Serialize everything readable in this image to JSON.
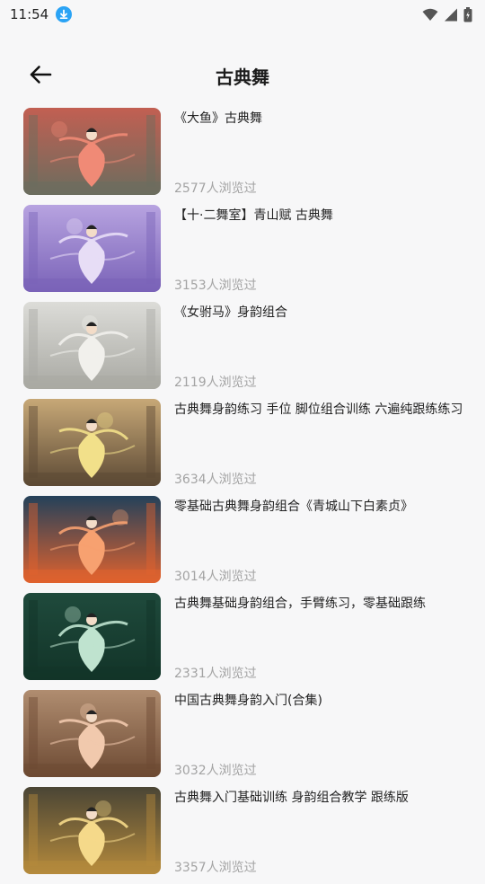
{
  "status": {
    "time": "11:54"
  },
  "header": {
    "title": "古典舞"
  },
  "items": [
    {
      "title": "《大鱼》古典舞",
      "views": "2577人浏览过",
      "thumb_colors": [
        "#c25f52",
        "#6b6d5e",
        "#f08a76"
      ]
    },
    {
      "title": "【十·二舞室】青山赋 古典舞",
      "views": "3153人浏览过",
      "thumb_colors": [
        "#b7a3e0",
        "#7a63b8",
        "#e7ddf6"
      ]
    },
    {
      "title": "《女驸马》身韵组合",
      "views": "2119人浏览过",
      "thumb_colors": [
        "#dcdcd8",
        "#a9a9a3",
        "#f1f0ec"
      ]
    },
    {
      "title": "古典舞身韵练习 手位 脚位组合训练 六遍纯跟练练习",
      "views": "3634人浏览过",
      "thumb_colors": [
        "#c7a877",
        "#5d4a35",
        "#f2e08a"
      ]
    },
    {
      "title": "零基础古典舞身韵组合《青城山下白素贞》",
      "views": "3014人浏览过",
      "thumb_colors": [
        "#24415a",
        "#e0622e",
        "#f7a170"
      ]
    },
    {
      "title": "古典舞基础身韵组合，手臂练习，零基础跟练",
      "views": "2331人浏览过",
      "thumb_colors": [
        "#1f4a3c",
        "#123428",
        "#bfe3cf"
      ]
    },
    {
      "title": "中国古典舞身韵入门(合集)",
      "views": "3032人浏览过",
      "thumb_colors": [
        "#b08d70",
        "#6d4a33",
        "#f1c9ad"
      ]
    },
    {
      "title": "古典舞入门基础训练 身韵组合教学 跟练版",
      "views": "3357人浏览过",
      "thumb_colors": [
        "#4a4535",
        "#b58a3c",
        "#f5d98a"
      ]
    }
  ]
}
